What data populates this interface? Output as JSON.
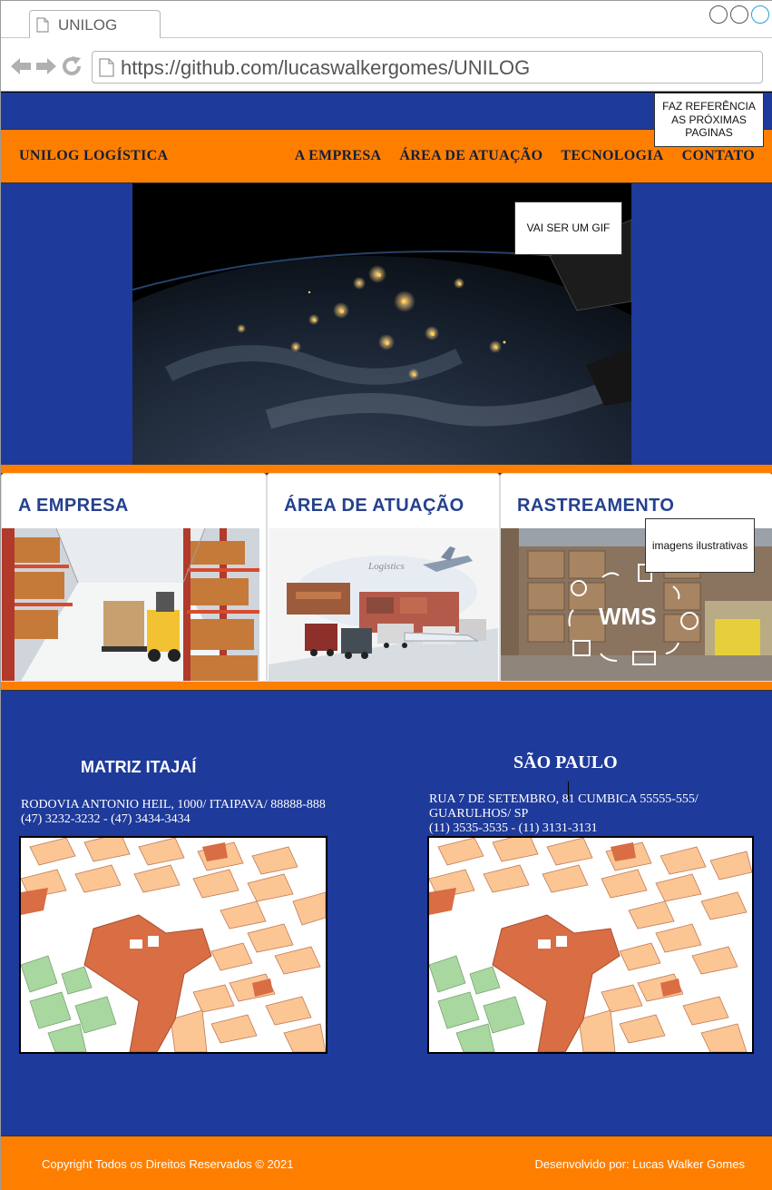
{
  "browser": {
    "tab_title": "UNILOG",
    "url": "https://github.com/lucaswalkergomes/UNILOG"
  },
  "notes": {
    "references": "FAZ REFERÊNCIA AS PRÓXIMAS PAGINAS",
    "gif": "VAI SER UM GIF",
    "illustrative": "imagens ilustrativas"
  },
  "nav": {
    "brand": "UNILOG LOGÍSTICA",
    "links": [
      "A EMPRESA",
      "ÁREA DE ATUAÇÃO",
      "TECNOLOGIA",
      "CONTATO"
    ]
  },
  "cards": [
    {
      "title": "A EMPRESA"
    },
    {
      "title": "ÁREA DE ATUAÇÃO",
      "image_text": "Logistics"
    },
    {
      "title": "RASTREAMENTO",
      "image_text": "WMS"
    }
  ],
  "locations": [
    {
      "title": "MATRIZ ITAJAÍ",
      "address_line1": "RODOVIA ANTONIO HEIL, 1000/ ITAIPAVA/ 88888-888",
      "address_line2": "(47) 3232-3232 - (47) 3434-3434"
    },
    {
      "title": "SÃO PAULO",
      "address_line1": "RUA 7 DE SETEMBRO, 81 CUMBICA 55555-555/",
      "address_line2": "GUARULHOS/ SP",
      "address_line3": "(11) 3535-3535 - (11) 3131-3131"
    }
  ],
  "footer": {
    "copyright": "Copyright Todos os Direitos Reservados © 2021",
    "credit": "Desenvolvido por: Lucas Walker Gomes"
  },
  "colors": {
    "navy": "#1e3a9a",
    "orange": "#fe7f00",
    "title_blue": "#25418e"
  }
}
